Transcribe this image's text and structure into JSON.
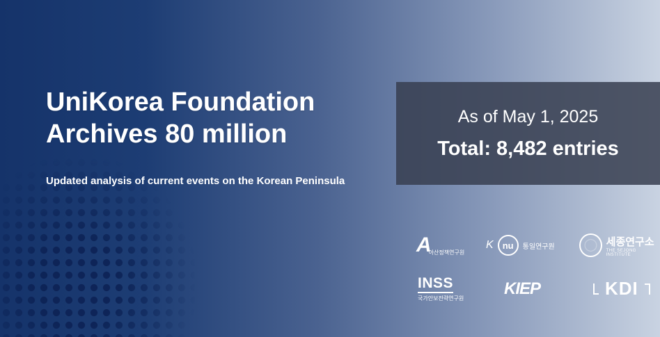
{
  "headline": {
    "line1": "UniKorea Foundation",
    "line2": "Archives 80 million"
  },
  "subtitle": "Updated analysis of current events on the Korean Peninsula",
  "status": {
    "date": "As of May 1, 2025",
    "total": "Total: 8,482 entries"
  },
  "logos": {
    "asan": {
      "mark": "A",
      "sub": "아산정책연구원"
    },
    "kinu": {
      "k": "K",
      "ring": "nu",
      "sub": "통일연구원"
    },
    "sejong": {
      "ko": "세종연구소",
      "en": "THE SEJONG INSTITUTE"
    },
    "inss": {
      "mark": "INSS",
      "sub": "국가안보전략연구원"
    },
    "kiep": "KIEP",
    "kdi": "KDI"
  },
  "colors": {
    "gradient_start": "#15336a",
    "gradient_end": "#c9d3e2",
    "status_box": "#373e50",
    "text": "#ffffff"
  }
}
